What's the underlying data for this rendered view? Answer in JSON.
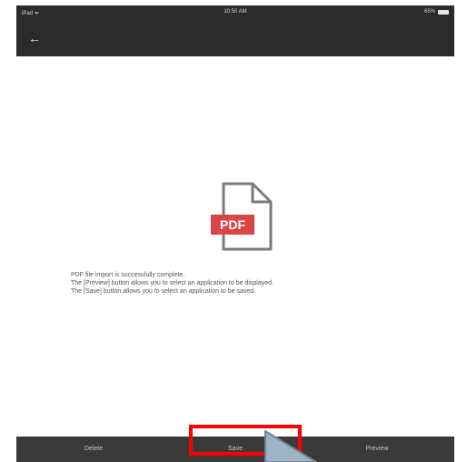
{
  "status_bar": {
    "carrier": "iPad ᯤ",
    "time": "10:50 AM",
    "battery": "65%",
    "battery_icon": "battery-icon"
  },
  "app_bar": {
    "back_icon": "arrow-left-icon",
    "back_glyph": "←"
  },
  "main": {
    "file_icon": "pdf-file-icon",
    "file_badge": "PDF",
    "message_lines": [
      "PDF file import is successfully complete.",
      "The [Preview] button allows you to select an application to be displayed.",
      "The [Save] button allows you to select an application to be saved."
    ]
  },
  "bottom_bar": {
    "delete_label": "Delete",
    "save_label": "Save",
    "preview_label": "Preview"
  },
  "colors": {
    "bar_dark": "#2b2b2b",
    "bottom_bar": "#3a3a3a",
    "pdf_red": "#d94545",
    "highlight": "#ff0000",
    "pointer": "#9fb3c6"
  }
}
